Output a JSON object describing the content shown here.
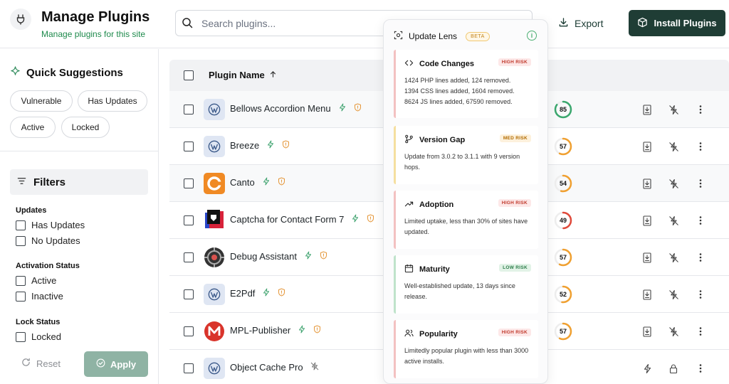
{
  "header": {
    "title": "Manage Plugins",
    "subtitle": "Manage plugins for this site",
    "search_placeholder": "Search plugins...",
    "export_label": "Export",
    "install_label": "Install Plugins"
  },
  "sidebar": {
    "quick_title": "Quick Suggestions",
    "chips": [
      "Vulnerable",
      "Has Updates",
      "Active",
      "Locked"
    ],
    "filters_title": "Filters",
    "groups": [
      {
        "title": "Updates",
        "options": [
          "Has Updates",
          "No Updates"
        ]
      },
      {
        "title": "Activation Status",
        "options": [
          "Active",
          "Inactive"
        ]
      },
      {
        "title": "Lock Status",
        "options": [
          "Locked"
        ]
      }
    ],
    "reset_label": "Reset",
    "apply_label": "Apply"
  },
  "table": {
    "col_plugin_name": "Plugin Name",
    "rows": [
      {
        "name": "Bellows Accordion Menu",
        "logo": "wordpress-icon",
        "score": "85",
        "score_value": 85,
        "score_color": "#3aa76d"
      },
      {
        "name": "Breeze",
        "logo": "wordpress-icon",
        "score": "57",
        "score_value": 57,
        "score_color": "#f0a030"
      },
      {
        "name": "Canto",
        "logo": "canto-icon",
        "score": "54",
        "score_value": 54,
        "score_color": "#f0a030"
      },
      {
        "name": "Captcha for Contact Form 7",
        "logo": "captcha-icon",
        "score": "49",
        "score_value": 49,
        "score_color": "#e0493a"
      },
      {
        "name": "Debug Assistant",
        "logo": "debug-icon",
        "score": "57",
        "score_value": 57,
        "score_color": "#f0a030"
      },
      {
        "name": "E2Pdf",
        "logo": "wordpress-icon",
        "score": "52",
        "score_value": 52,
        "score_color": "#f0a030"
      },
      {
        "name": "MPL-Publisher",
        "logo": "mpl-icon",
        "score": "57",
        "score_value": 57,
        "score_color": "#f0a030"
      },
      {
        "name": "Object Cache Pro",
        "logo": "wordpress-icon",
        "score": "",
        "score_value": null,
        "score_color": ""
      }
    ]
  },
  "lens": {
    "title": "Update Lens",
    "beta": "BETA",
    "cards": [
      {
        "title": "Code Changes",
        "risk": "HIGH RISK",
        "risk_level": "high",
        "icon": "code-icon",
        "lines": [
          "1424 PHP lines added, 124 removed.",
          "1394 CSS lines added, 1604 removed.",
          "8624 JS lines added, 67590 removed."
        ]
      },
      {
        "title": "Version Gap",
        "risk": "MED RISK",
        "risk_level": "med",
        "icon": "branch-icon",
        "lines": [
          "Update from 3.0.2 to 3.1.1 with 9 version hops."
        ]
      },
      {
        "title": "Adoption",
        "risk": "HIGH RISK",
        "risk_level": "high",
        "icon": "trend-icon",
        "lines": [
          "Limited uptake, less than 30% of sites have updated."
        ]
      },
      {
        "title": "Maturity",
        "risk": "LOW RISK",
        "risk_level": "low",
        "icon": "calendar-icon",
        "lines": [
          "Well-established update, 13 days since release."
        ]
      },
      {
        "title": "Popularity",
        "risk": "HIGH RISK",
        "risk_level": "high",
        "icon": "users-icon",
        "lines": [
          "Limitedly popular plugin with less than 3000 active installs."
        ]
      }
    ]
  }
}
